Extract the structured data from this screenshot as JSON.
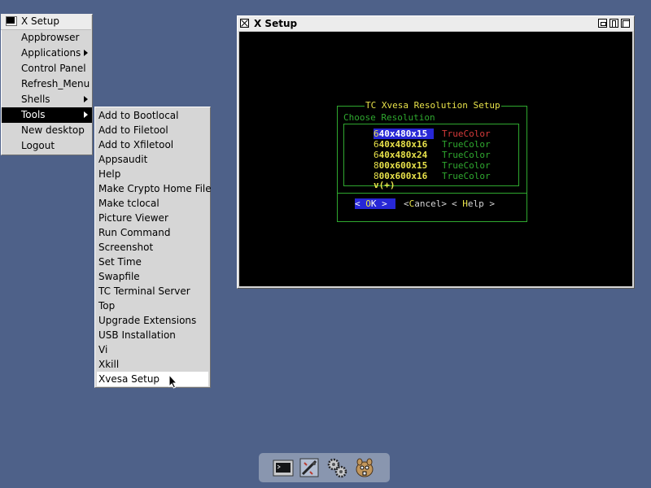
{
  "root_menu": {
    "title": "X Setup",
    "items": [
      {
        "label": "Appbrowser",
        "submenu": false
      },
      {
        "label": "Applications",
        "submenu": true
      },
      {
        "label": "Control Panel",
        "submenu": false
      },
      {
        "label": "Refresh_Menu",
        "submenu": false
      },
      {
        "label": "Shells",
        "submenu": true
      },
      {
        "label": "Tools",
        "submenu": true,
        "active": true
      },
      {
        "label": "New desktop",
        "submenu": false
      },
      {
        "label": "Logout",
        "submenu": false
      }
    ]
  },
  "tools_menu": {
    "items": [
      "Add to Bootlocal",
      "Add to Filetool",
      "Add to Xfiletool",
      "Appsaudit",
      "Help",
      "Make Crypto Home File",
      "Make tclocal",
      "Picture Viewer",
      "Run Command",
      "Screenshot",
      "Set Time",
      "Swapfile",
      "TC Terminal Server",
      "Top",
      "Upgrade Extensions",
      "USB Installation",
      "Vi",
      "Xkill",
      "Xvesa Setup"
    ],
    "active_index": 18
  },
  "window": {
    "title": "X Setup",
    "dialog": {
      "title": "TC Xvesa Resolution Setup",
      "subtitle": "Choose Resolution",
      "options": [
        {
          "hotkey": "6",
          "rest": "40x480x15",
          "depth": "TrueColor",
          "selected": true
        },
        {
          "hotkey": "6",
          "rest": "40x480x16",
          "depth": "TrueColor",
          "selected": false
        },
        {
          "hotkey": "6",
          "rest": "40x480x24",
          "depth": "TrueColor",
          "selected": false
        },
        {
          "hotkey": "8",
          "rest": "00x600x15",
          "depth": "TrueColor",
          "selected": false
        },
        {
          "hotkey": "8",
          "rest": "00x600x16",
          "depth": "TrueColor",
          "selected": false
        }
      ],
      "more_indicator": "v(+)",
      "buttons": {
        "ok": {
          "pre": "< ",
          "hotkey": "O",
          "rest": "K",
          "post": " >"
        },
        "cancel": {
          "pre": "<",
          "hotkey": "C",
          "rest": "ancel",
          "post": ">"
        },
        "help": {
          "pre": "< ",
          "hotkey": "H",
          "rest": "elp",
          "post": " >"
        }
      }
    }
  },
  "dock": {
    "icons": [
      "terminal-icon",
      "control-panel-icon",
      "settings-gears-icon",
      "mascot-icon"
    ]
  },
  "colors": {
    "desktop": "#4e6189",
    "menu_bg": "#d6d6d6",
    "dialog_border": "#2fa82f",
    "dialog_title": "#e8e24a",
    "selection": "#2727d6"
  }
}
